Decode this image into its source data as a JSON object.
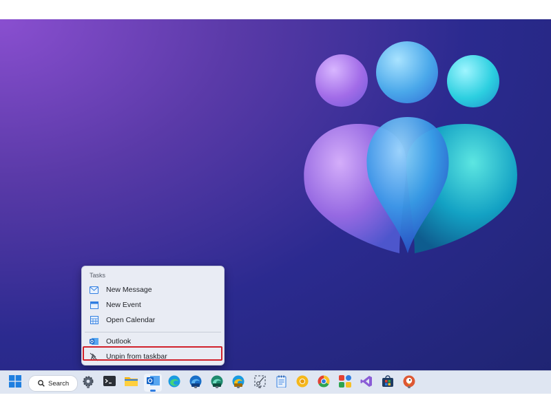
{
  "context_menu": {
    "header": "Tasks",
    "items": [
      {
        "label": "New Message",
        "icon": "new-message-icon"
      },
      {
        "label": "New Event",
        "icon": "new-event-icon"
      },
      {
        "label": "Open Calendar",
        "icon": "calendar-icon"
      },
      {
        "label": "Outlook",
        "icon": "outlook-icon"
      },
      {
        "label": "Unpin from taskbar",
        "icon": "unpin-icon"
      }
    ],
    "highlight_color": "#d0202a"
  },
  "taskbar": {
    "search_label": "Search",
    "apps": [
      {
        "name": "start",
        "icon": "windows-start-icon"
      },
      {
        "name": "settings",
        "icon": "gear-icon"
      },
      {
        "name": "terminal",
        "icon": "terminal-icon"
      },
      {
        "name": "file-explorer",
        "icon": "folder-icon"
      },
      {
        "name": "outlook",
        "icon": "outlook-icon"
      },
      {
        "name": "edge",
        "icon": "edge-icon"
      },
      {
        "name": "edge-beta",
        "icon": "edge-beta-icon",
        "badge": "BETA"
      },
      {
        "name": "edge-dev",
        "icon": "edge-dev-icon",
        "badge": "DEV"
      },
      {
        "name": "edge-canary",
        "icon": "edge-canary-icon",
        "badge": "CAN"
      },
      {
        "name": "snipping-tool",
        "icon": "snipping-tool-icon"
      },
      {
        "name": "notepad",
        "icon": "notepad-icon"
      },
      {
        "name": "chrome-canary",
        "icon": "chrome-canary-icon"
      },
      {
        "name": "chrome",
        "icon": "chrome-icon"
      },
      {
        "name": "app",
        "icon": "colorful-app-icon"
      },
      {
        "name": "visual-studio",
        "icon": "visual-studio-icon"
      },
      {
        "name": "store",
        "icon": "store-icon"
      },
      {
        "name": "duckduckgo",
        "icon": "duckduckgo-icon"
      }
    ]
  },
  "colors": {
    "accent_blue": "#2f7de1",
    "taskbar_bg": "#dfe6f2",
    "menu_bg": "#e9ecf4"
  }
}
